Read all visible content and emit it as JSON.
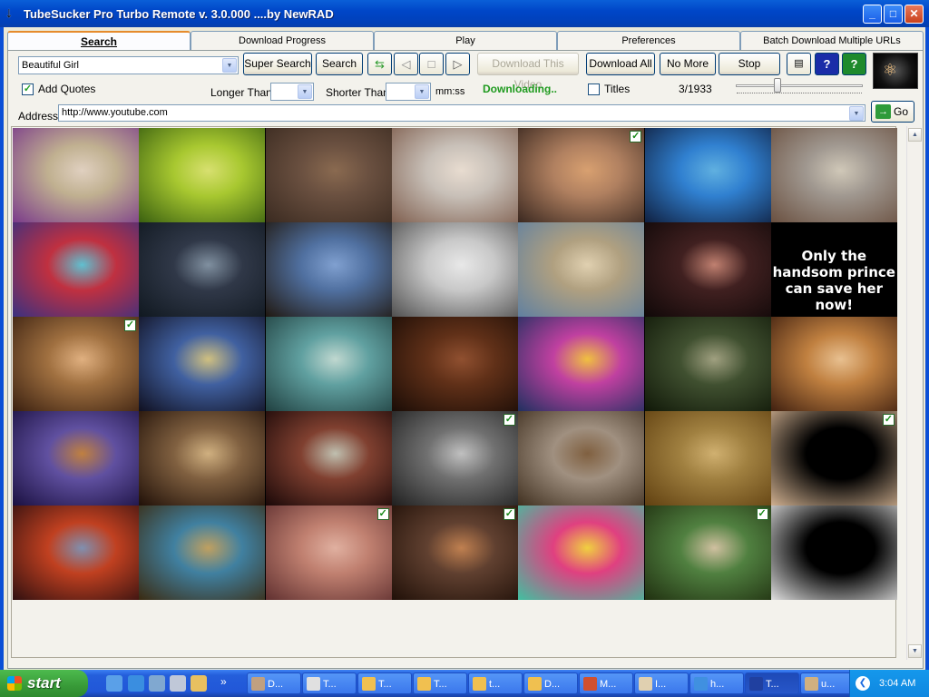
{
  "window": {
    "title": "TubeSucker Pro Turbo Remote  v. 3.0.000     ....by NewRAD"
  },
  "tabs": [
    "Search",
    "Download Progress",
    "Play",
    "Preferences",
    "Batch Download Multiple URLs"
  ],
  "search": {
    "query": "Beautiful Girl",
    "super_search_label": "Super Search",
    "search_label": "Search",
    "download_this_label": "Download This Video",
    "download_all_label": "Download All",
    "no_more_label": "No More",
    "stop_label": "Stop",
    "add_quotes_label": "Add Quotes",
    "add_quotes_checked": true,
    "longer_than_label": "Longer Than",
    "longer_than_value": "",
    "shorter_than_label": "Shorter Than",
    "shorter_than_value": "",
    "time_unit": "mm:ss",
    "status": "Downloading..",
    "titles_label": "Titles",
    "titles_checked": false,
    "progress": "3/1933",
    "slider_position": 0.32
  },
  "address": {
    "label": "Address",
    "value": "http://www.youtube.com",
    "go_label": "Go"
  },
  "grid": {
    "columns": 7,
    "thumbnails": [
      {
        "colors": [
          "#c0b090",
          "#7a3a8a",
          "#e0d0c0"
        ],
        "checked": false,
        "caption": ""
      },
      {
        "colors": [
          "#a8c830",
          "#3a6010",
          "#d8e070"
        ],
        "checked": false,
        "caption": ""
      },
      {
        "colors": [
          "#6a5040",
          "#3a2a20",
          "#8a6a50"
        ],
        "checked": false,
        "caption": ""
      },
      {
        "colors": [
          "#c8c0b8",
          "#806050",
          "#e8dcd0"
        ],
        "checked": false,
        "caption": ""
      },
      {
        "colors": [
          "#b08060",
          "#3a2820",
          "#d8a070"
        ],
        "checked": true,
        "caption": ""
      },
      {
        "colors": [
          "#3080d0",
          "#102040",
          "#60b0e0"
        ],
        "checked": false,
        "caption": ""
      },
      {
        "colors": [
          "#a09890",
          "#6a5040",
          "#d0c8b8"
        ],
        "checked": false,
        "caption": ""
      },
      {
        "colors": [
          "#c03040",
          "#3a3080",
          "#60c0d0"
        ],
        "checked": false,
        "caption": ""
      },
      {
        "colors": [
          "#303848",
          "#101820",
          "#8090a0"
        ],
        "checked": false,
        "caption": ""
      },
      {
        "colors": [
          "#5070a0",
          "#201810",
          "#80a0d0"
        ],
        "checked": false,
        "caption": ""
      },
      {
        "colors": [
          "#c8c8c8",
          "#505050",
          "#e8e8e8"
        ],
        "checked": false,
        "caption": ""
      },
      {
        "colors": [
          "#b0a080",
          "#6080a0",
          "#e0d0b0"
        ],
        "checked": false,
        "caption": ""
      },
      {
        "colors": [
          "#402020",
          "#100808",
          "#c08070"
        ],
        "checked": false,
        "caption": ""
      },
      {
        "colors": [
          "#000000",
          "#000000",
          "#000000"
        ],
        "checked": false,
        "caption": "Only the handsom prince can save her now!"
      },
      {
        "colors": [
          "#a07040",
          "#3a2010",
          "#e0b080"
        ],
        "checked": true,
        "caption": ""
      },
      {
        "colors": [
          "#4060a0",
          "#101020",
          "#d0c080"
        ],
        "checked": false,
        "caption": ""
      },
      {
        "colors": [
          "#60a0a0",
          "#204040",
          "#c0d8d0"
        ],
        "checked": false,
        "caption": ""
      },
      {
        "colors": [
          "#603018",
          "#1a0c06",
          "#905030"
        ],
        "checked": false,
        "caption": ""
      },
      {
        "colors": [
          "#c040a0",
          "#203060",
          "#f0c040"
        ],
        "checked": false,
        "caption": ""
      },
      {
        "colors": [
          "#405030",
          "#101808",
          "#a0a080"
        ],
        "checked": false,
        "caption": ""
      },
      {
        "colors": [
          "#c08040",
          "#402010",
          "#e8c090"
        ],
        "checked": false,
        "caption": ""
      },
      {
        "colors": [
          "#6050a0",
          "#1a1040",
          "#c08040"
        ],
        "checked": false,
        "caption": ""
      },
      {
        "colors": [
          "#806040",
          "#201008",
          "#d0b080"
        ],
        "checked": false,
        "caption": ""
      },
      {
        "colors": [
          "#804030",
          "#1a0808",
          "#c0c0b0"
        ],
        "checked": false,
        "caption": ""
      },
      {
        "colors": [
          "#707070",
          "#202020",
          "#c0c0c0"
        ],
        "checked": true,
        "caption": ""
      },
      {
        "colors": [
          "#a09080",
          "#403020",
          "#806040"
        ],
        "checked": false,
        "caption": ""
      },
      {
        "colors": [
          "#a08040",
          "#604010",
          "#d0b070"
        ],
        "checked": false,
        "caption": ""
      },
      {
        "colors": [
          "#000000",
          "#d0b090",
          "#000000"
        ],
        "checked": true,
        "caption": ""
      },
      {
        "colors": [
          "#c04020",
          "#301010",
          "#8090b0"
        ],
        "checked": false,
        "caption": ""
      },
      {
        "colors": [
          "#4080a0",
          "#3a2a10",
          "#c0a060"
        ],
        "checked": false,
        "caption": ""
      },
      {
        "colors": [
          "#c08070",
          "#603030",
          "#e0b0a0"
        ],
        "checked": true,
        "caption": ""
      },
      {
        "colors": [
          "#604030",
          "#201008",
          "#c08050"
        ],
        "checked": true,
        "caption": ""
      },
      {
        "colors": [
          "#e04080",
          "#40c0a0",
          "#f0d040"
        ],
        "checked": false,
        "caption": ""
      },
      {
        "colors": [
          "#508040",
          "#203010",
          "#d0c0a0"
        ],
        "checked": true,
        "caption": ""
      },
      {
        "colors": [
          "#000000",
          "#e0e0e0",
          "#000000"
        ],
        "checked": false,
        "caption": ""
      }
    ]
  },
  "taskbar": {
    "start_label": "start",
    "tasks": [
      "D...",
      "T...",
      "T...",
      "T...",
      "t...",
      "D...",
      "M...",
      "I...",
      "h...",
      "T...",
      "u..."
    ],
    "clock": "3:04 AM"
  }
}
